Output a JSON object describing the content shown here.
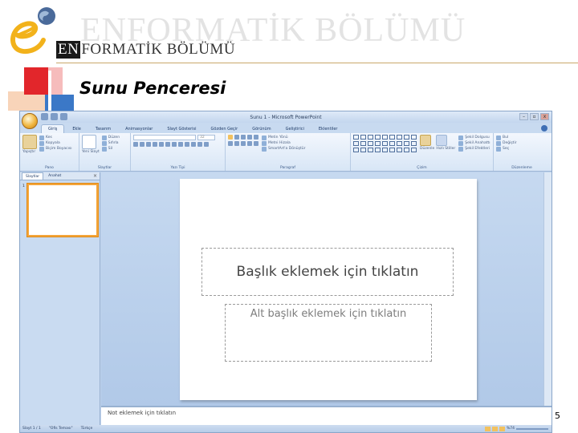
{
  "header": {
    "watermark": "ENFORMATİK BÖLÜMÜ",
    "brand_en": "EN",
    "brand_rest": "FORMATİK BÖLÜMÜ"
  },
  "slide_title": "Sunu Penceresi",
  "page_number": "5",
  "colors": {
    "accent_orange": "#f4a53a",
    "deco_red": "#e2262b",
    "deco_blue": "#3b78c7",
    "rule_gold": "#c9a86a"
  },
  "ppt": {
    "window_title": "Sunu 1 - Microsoft PowerPoint",
    "window_controls": [
      "–",
      "▫",
      "x"
    ],
    "tabs": [
      "Giriş",
      "Ekle",
      "Tasarım",
      "Animasyonlar",
      "Slayt Gösterisi",
      "Gözden Geçir",
      "Görünüm",
      "Geliştirici",
      "Eklentiler"
    ],
    "ribbon": {
      "pano": {
        "label": "Pano",
        "paste": "Yapıştır",
        "cut": "Kes",
        "copy": "Kopyala",
        "format_painter": "Biçim Boyacısı"
      },
      "slaytlar": {
        "label": "Slaytlar",
        "new_slide": "Yeni Slayt",
        "layout": "Düzen",
        "reset": "Sıfırla",
        "delete": "Sil"
      },
      "yazi_tipi": {
        "label": "Yazı Tipi",
        "size": "32"
      },
      "paragraf": {
        "label": "Paragraf",
        "text_direction": "Metin Yönü",
        "align_text": "Metni Hizala",
        "smartart": "SmartArt'a Dönüştür"
      },
      "cizim": {
        "label": "Çizim",
        "arrange": "Düzenle",
        "quick_styles": "Hızlı Stiller",
        "shape_fill": "Şekil Dolgusu",
        "shape_outline": "Şekil Anahattı",
        "shape_effects": "Şekil Efektleri"
      },
      "duzenleme": {
        "label": "Düzenleme",
        "find": "Bul",
        "replace": "Değiştir",
        "select": "Seç"
      }
    },
    "pane_tabs": [
      "Slaytlar",
      "Anahat"
    ],
    "thumb_number": "1",
    "title_placeholder": "Başlık eklemek için tıklatın",
    "subtitle_placeholder": "Alt başlık eklemek için tıklatın",
    "notes_placeholder": "Not eklemek için tıklatın",
    "status": {
      "slide": "Slayt 1 / 1",
      "theme": "\"Ofis Teması\"",
      "language": "Türkçe",
      "zoom": "%74"
    }
  }
}
